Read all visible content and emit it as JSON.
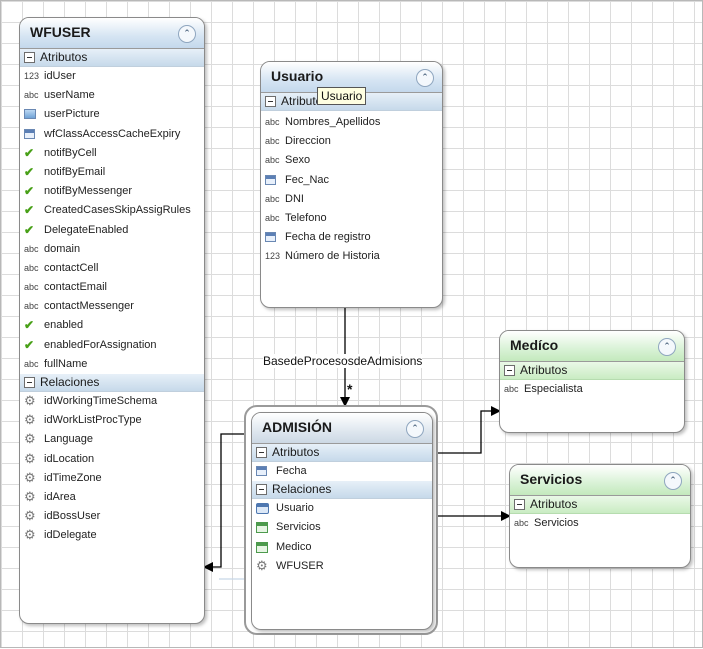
{
  "entities": {
    "wfuser": {
      "title": "WFUSER",
      "attr_section": "Atributos",
      "rel_section": "Relaciones",
      "attributes": [
        {
          "icon": "123",
          "label": "idUser"
        },
        {
          "icon": "abc",
          "label": "userName"
        },
        {
          "icon": "image",
          "label": "userPicture"
        },
        {
          "icon": "calendar",
          "label": "wfClassAccessCacheExpiry"
        },
        {
          "icon": "check",
          "label": "notifByCell"
        },
        {
          "icon": "check",
          "label": "notifByEmail"
        },
        {
          "icon": "check",
          "label": "notifByMessenger"
        },
        {
          "icon": "check",
          "label": "CreatedCasesSkipAssigRules"
        },
        {
          "icon": "check",
          "label": "DelegateEnabled"
        },
        {
          "icon": "abc",
          "label": "domain"
        },
        {
          "icon": "abc",
          "label": "contactCell"
        },
        {
          "icon": "abc",
          "label": "contactEmail"
        },
        {
          "icon": "abc",
          "label": "contactMessenger"
        },
        {
          "icon": "check",
          "label": "enabled"
        },
        {
          "icon": "check",
          "label": "enabledForAssignation"
        },
        {
          "icon": "abc",
          "label": "fullName"
        }
      ],
      "relations": [
        {
          "icon": "gear",
          "label": "idWorkingTimeSchema"
        },
        {
          "icon": "gear",
          "label": "idWorkListProcType"
        },
        {
          "icon": "gear",
          "label": "Language"
        },
        {
          "icon": "gear",
          "label": "idLocation"
        },
        {
          "icon": "gear",
          "label": "idTimeZone"
        },
        {
          "icon": "gear",
          "label": "idArea"
        },
        {
          "icon": "gear",
          "label": "idBossUser"
        },
        {
          "icon": "gear",
          "label": "idDelegate"
        }
      ]
    },
    "usuario": {
      "title": "Usuario",
      "tooltip": "Usuario",
      "attr_section": "Atributos",
      "attributes": [
        {
          "icon": "abc",
          "label": "Nombres_Apellidos"
        },
        {
          "icon": "abc",
          "label": "Direccion"
        },
        {
          "icon": "abc",
          "label": "Sexo"
        },
        {
          "icon": "calendar",
          "label": "Fec_Nac"
        },
        {
          "icon": "abc",
          "label": "DNI"
        },
        {
          "icon": "abc",
          "label": "Telefono"
        },
        {
          "icon": "calendar",
          "label": "Fecha de registro"
        },
        {
          "icon": "123",
          "label": "Número de Historia"
        }
      ]
    },
    "admision": {
      "title": "ADMISIÓN",
      "attr_section": "Atributos",
      "rel_section": "Relaciones",
      "attributes": [
        {
          "icon": "calendar",
          "label": "Fecha"
        }
      ],
      "relations": [
        {
          "icon": "entity",
          "label": "Usuario"
        },
        {
          "icon": "table",
          "label": "Servicios"
        },
        {
          "icon": "table",
          "label": "Medico"
        },
        {
          "icon": "gear",
          "label": "WFUSER"
        }
      ]
    },
    "medico": {
      "title": "Medíco",
      "attr_section": "Atributos",
      "attributes": [
        {
          "icon": "abc",
          "label": "Especialista"
        }
      ]
    },
    "servicios": {
      "title": "Servicios",
      "attr_section": "Atributos",
      "attributes": [
        {
          "icon": "abc",
          "label": "Servicios"
        }
      ]
    }
  },
  "relationship_label": "BasedeProcesosdeAdmisions",
  "multiplicity": "*",
  "icon_glyphs": {
    "123": "123",
    "abc": "abc",
    "check": "✔",
    "gear": "⚙"
  },
  "colors": {
    "header_blue": "#c4d8ec",
    "header_green": "#c3e9bd",
    "check_green": "#48a017",
    "connector": "#000000"
  }
}
